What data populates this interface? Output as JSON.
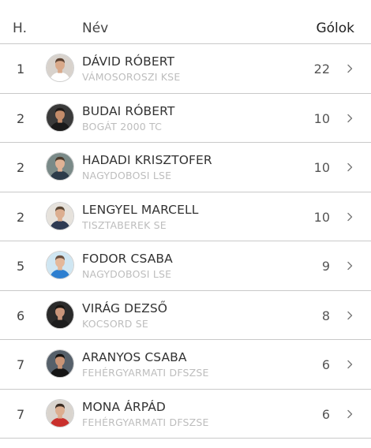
{
  "header": {
    "rank_label": "H.",
    "name_label": "Név",
    "goals_label": "Gólok"
  },
  "rows": [
    {
      "rank": "1",
      "name": "DÁVID RÓBERT",
      "club": "VÁMOSOROSZI KSE",
      "goals": "22",
      "avatar_bg": "#d8d2cc",
      "shirt": "#ffffff",
      "skin": "#d9a98a",
      "hair": "#5a4030"
    },
    {
      "rank": "2",
      "name": "BUDAI RÓBERT",
      "club": "BOGÁT 2000 TC",
      "goals": "10",
      "avatar_bg": "#3a3a3a",
      "shirt": "#1a1a1a",
      "skin": "#c48c6a",
      "hair": "#1e1a18"
    },
    {
      "rank": "2",
      "name": "HADADI KRISZTOFER",
      "club": "NAGYDOBOSI LSE",
      "goals": "10",
      "avatar_bg": "#7a8a88",
      "shirt": "#2c3b4a",
      "skin": "#e0b295",
      "hair": "#4a3a2c"
    },
    {
      "rank": "2",
      "name": "LENGYEL MARCELL",
      "club": "TISZTABEREK SE",
      "goals": "10",
      "avatar_bg": "#e6e2dc",
      "shirt": "#2e3a52",
      "skin": "#dcae90",
      "hair": "#5a4634"
    },
    {
      "rank": "5",
      "name": "FODOR CSABA",
      "club": "NAGYDOBOSI LSE",
      "goals": "9",
      "avatar_bg": "#cfe6f2",
      "shirt": "#2d7fd0",
      "skin": "#e4b89a",
      "hair": "#6a5040"
    },
    {
      "rank": "6",
      "name": "VIRÁG DEZSŐ",
      "club": "KOCSORD SE",
      "goals": "8",
      "avatar_bg": "#2a2a2a",
      "shirt": "#1d1d1d",
      "skin": "#c9957a",
      "hair": "#171310"
    },
    {
      "rank": "7",
      "name": "ARANYOS CSABA",
      "club": "FEHÉRGYARMATI DFSZSE",
      "goals": "6",
      "avatar_bg": "#56606a",
      "shirt": "#151515",
      "skin": "#c99476",
      "hair": "#161210"
    },
    {
      "rank": "7",
      "name": "MONA ÁRPÁD",
      "club": "FEHÉRGYARMATI DFSZSE",
      "goals": "6",
      "avatar_bg": "#d9d4ce",
      "shirt": "#c9302c",
      "skin": "#dcae90",
      "hair": "#3a2c22"
    }
  ],
  "icons": {
    "avatar": "player-photo-icon",
    "chevron": "chevron-right-icon"
  },
  "colors": {
    "divider": "#c9c9c9",
    "club_text": "#bdbdbd",
    "name_text": "#333333"
  }
}
